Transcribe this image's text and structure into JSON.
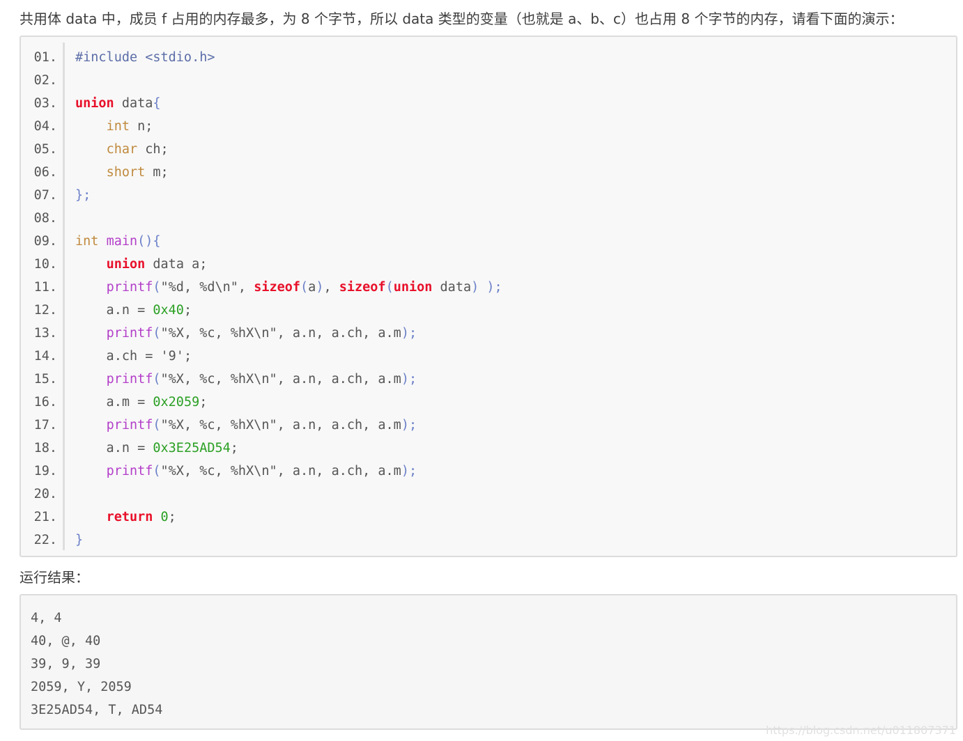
{
  "intro": {
    "text": "共用体 data 中，成员 f 占用的内存最多，为 8 个字节，所以 data 类型的变量（也就是 a、b、c）也占用 8 个字节的内存，请看下面的演示："
  },
  "code_block": {
    "lines": [
      {
        "no": "01.",
        "tokens": [
          {
            "t": "#include <stdio.h>",
            "k": "pp"
          }
        ]
      },
      {
        "no": "02.",
        "tokens": []
      },
      {
        "no": "03.",
        "tokens": [
          {
            "t": "union",
            "k": "kw"
          },
          {
            "t": " data",
            "k": "id"
          },
          {
            "t": "{",
            "k": "pn"
          }
        ]
      },
      {
        "no": "04.",
        "tokens": [
          {
            "t": "    ",
            "k": "id"
          },
          {
            "t": "int",
            "k": "type"
          },
          {
            "t": " n;",
            "k": "id"
          }
        ]
      },
      {
        "no": "05.",
        "tokens": [
          {
            "t": "    ",
            "k": "id"
          },
          {
            "t": "char",
            "k": "type"
          },
          {
            "t": " ch;",
            "k": "id"
          }
        ]
      },
      {
        "no": "06.",
        "tokens": [
          {
            "t": "    ",
            "k": "id"
          },
          {
            "t": "short",
            "k": "type"
          },
          {
            "t": " m;",
            "k": "id"
          }
        ]
      },
      {
        "no": "07.",
        "tokens": [
          {
            "t": "};",
            "k": "pn"
          }
        ]
      },
      {
        "no": "08.",
        "tokens": []
      },
      {
        "no": "09.",
        "tokens": [
          {
            "t": "int",
            "k": "type"
          },
          {
            "t": " ",
            "k": "id"
          },
          {
            "t": "main",
            "k": "fn"
          },
          {
            "t": "(){",
            "k": "pn"
          }
        ]
      },
      {
        "no": "10.",
        "tokens": [
          {
            "t": "    ",
            "k": "id"
          },
          {
            "t": "union",
            "k": "kw"
          },
          {
            "t": " data a;",
            "k": "id"
          }
        ]
      },
      {
        "no": "11.",
        "tokens": [
          {
            "t": "    ",
            "k": "id"
          },
          {
            "t": "printf",
            "k": "fn"
          },
          {
            "t": "(",
            "k": "pn"
          },
          {
            "t": "\"%d, %d\\n\"",
            "k": "str"
          },
          {
            "t": ", ",
            "k": "id"
          },
          {
            "t": "sizeof",
            "k": "kw"
          },
          {
            "t": "(",
            "k": "pn"
          },
          {
            "t": "a",
            "k": "id"
          },
          {
            "t": ")",
            "k": "pn"
          },
          {
            "t": ", ",
            "k": "id"
          },
          {
            "t": "sizeof",
            "k": "kw"
          },
          {
            "t": "(",
            "k": "pn"
          },
          {
            "t": "union",
            "k": "kw"
          },
          {
            "t": " data",
            "k": "id"
          },
          {
            "t": ") );",
            "k": "pn"
          }
        ]
      },
      {
        "no": "12.",
        "tokens": [
          {
            "t": "    a.n = ",
            "k": "id"
          },
          {
            "t": "0x40",
            "k": "num"
          },
          {
            "t": ";",
            "k": "id"
          }
        ]
      },
      {
        "no": "13.",
        "tokens": [
          {
            "t": "    ",
            "k": "id"
          },
          {
            "t": "printf",
            "k": "fn"
          },
          {
            "t": "(",
            "k": "pn"
          },
          {
            "t": "\"%X, %c, %hX\\n\"",
            "k": "str"
          },
          {
            "t": ", a.n, a.ch, a.m",
            "k": "id"
          },
          {
            "t": ");",
            "k": "pn"
          }
        ]
      },
      {
        "no": "14.",
        "tokens": [
          {
            "t": "    a.ch = ",
            "k": "id"
          },
          {
            "t": "'9'",
            "k": "str"
          },
          {
            "t": ";",
            "k": "id"
          }
        ]
      },
      {
        "no": "15.",
        "tokens": [
          {
            "t": "    ",
            "k": "id"
          },
          {
            "t": "printf",
            "k": "fn"
          },
          {
            "t": "(",
            "k": "pn"
          },
          {
            "t": "\"%X, %c, %hX\\n\"",
            "k": "str"
          },
          {
            "t": ", a.n, a.ch, a.m",
            "k": "id"
          },
          {
            "t": ");",
            "k": "pn"
          }
        ]
      },
      {
        "no": "16.",
        "tokens": [
          {
            "t": "    a.m = ",
            "k": "id"
          },
          {
            "t": "0x2059",
            "k": "num"
          },
          {
            "t": ";",
            "k": "id"
          }
        ]
      },
      {
        "no": "17.",
        "tokens": [
          {
            "t": "    ",
            "k": "id"
          },
          {
            "t": "printf",
            "k": "fn"
          },
          {
            "t": "(",
            "k": "pn"
          },
          {
            "t": "\"%X, %c, %hX\\n\"",
            "k": "str"
          },
          {
            "t": ", a.n, a.ch, a.m",
            "k": "id"
          },
          {
            "t": ");",
            "k": "pn"
          }
        ]
      },
      {
        "no": "18.",
        "tokens": [
          {
            "t": "    a.n = ",
            "k": "id"
          },
          {
            "t": "0x3E25AD54",
            "k": "num"
          },
          {
            "t": ";",
            "k": "id"
          }
        ]
      },
      {
        "no": "19.",
        "tokens": [
          {
            "t": "    ",
            "k": "id"
          },
          {
            "t": "printf",
            "k": "fn"
          },
          {
            "t": "(",
            "k": "pn"
          },
          {
            "t": "\"%X, %c, %hX\\n\"",
            "k": "str"
          },
          {
            "t": ", a.n, a.ch, a.m",
            "k": "id"
          },
          {
            "t": ");",
            "k": "pn"
          }
        ]
      },
      {
        "no": "20.",
        "tokens": []
      },
      {
        "no": "21.",
        "tokens": [
          {
            "t": "    ",
            "k": "id"
          },
          {
            "t": "return",
            "k": "kw"
          },
          {
            "t": " ",
            "k": "id"
          },
          {
            "t": "0",
            "k": "num"
          },
          {
            "t": ";",
            "k": "id"
          }
        ]
      },
      {
        "no": "22.",
        "tokens": [
          {
            "t": "}",
            "k": "pn"
          }
        ]
      }
    ]
  },
  "result": {
    "label": "运行结果：",
    "lines": [
      "4, 4",
      "40, @, 40",
      "39, 9, 39",
      "2059, Y, 2059",
      "3E25AD54, T, AD54"
    ]
  },
  "watermark": {
    "text": "https://blog.csdn.net/u011807371"
  },
  "colors": {
    "preprocessor": "#5c6ea8",
    "keyword": "#e8102a",
    "type": "#c08a3e",
    "function": "#b33fc9",
    "number": "#2ba024",
    "punctuation": "#6a7fc8",
    "text": "#555555"
  }
}
